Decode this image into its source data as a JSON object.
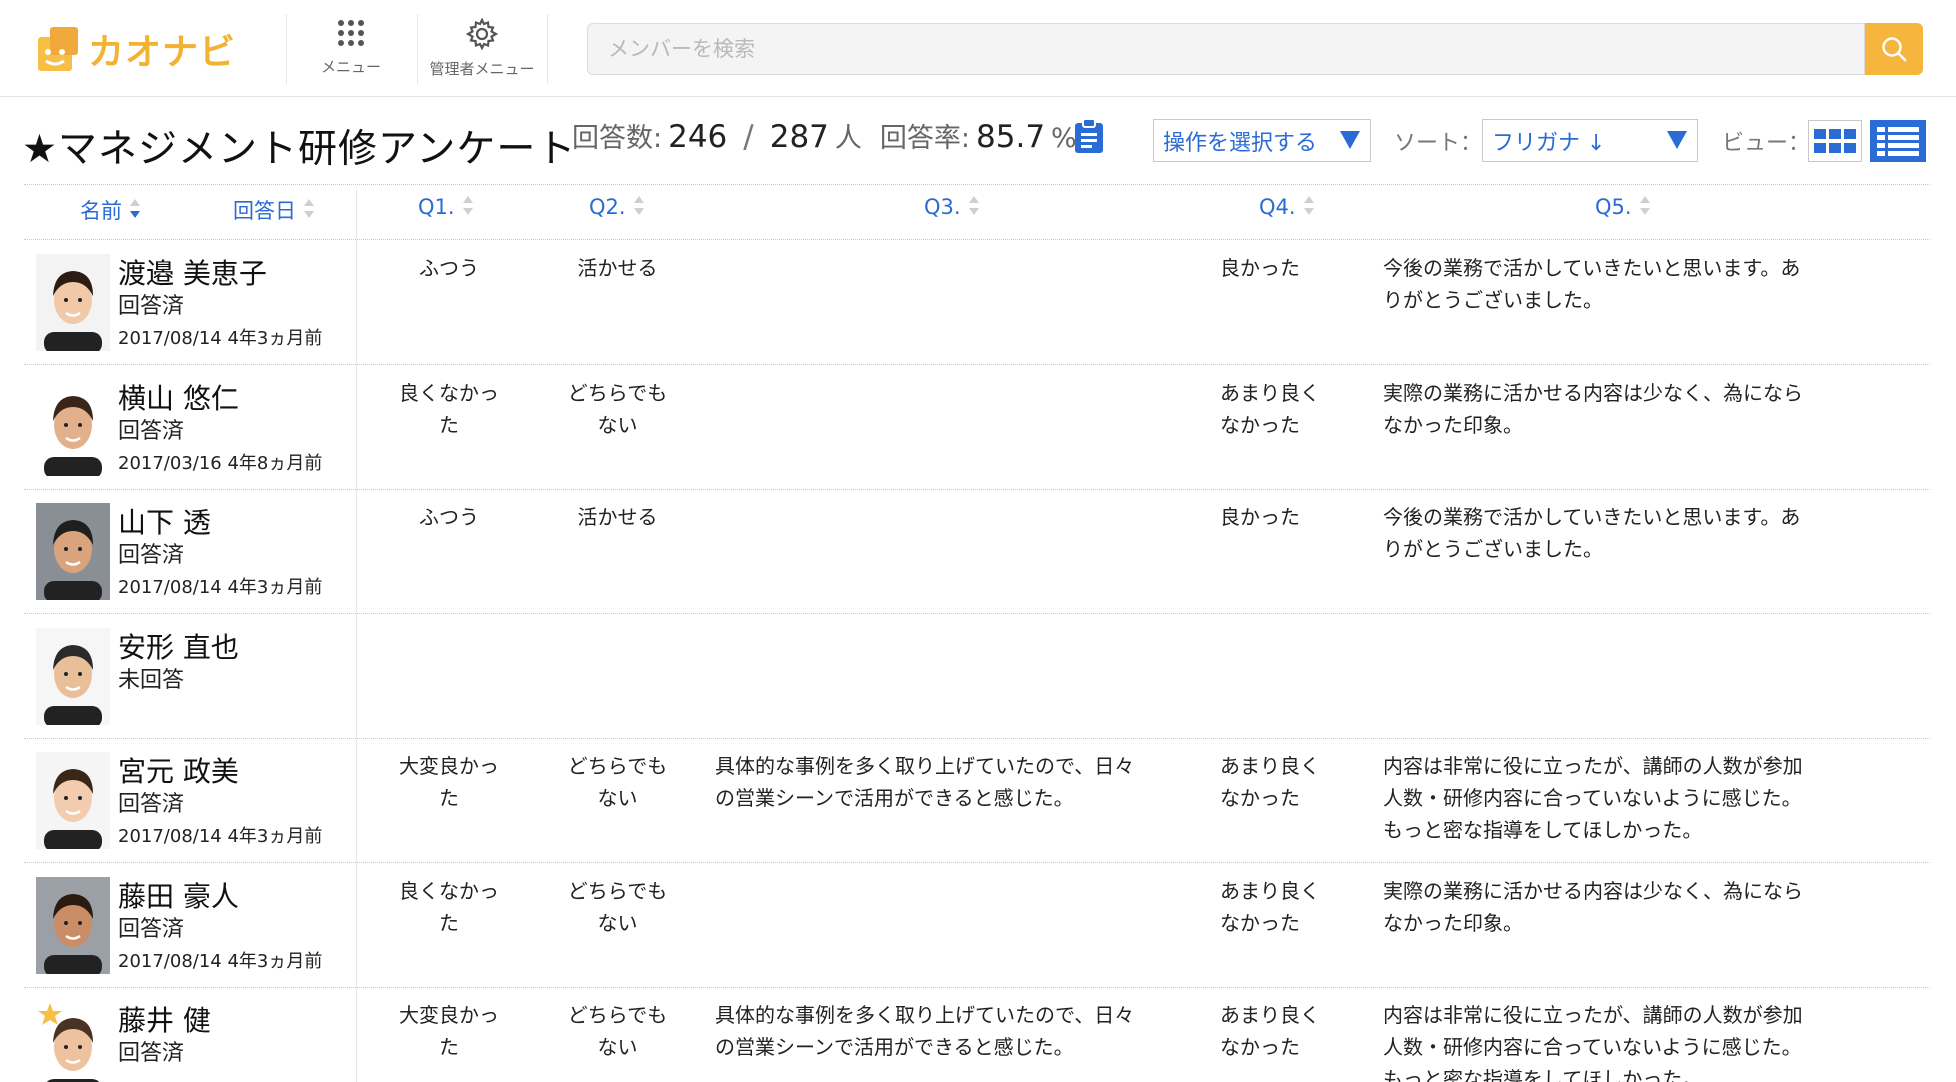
{
  "header": {
    "logo_text": "カオナビ",
    "menu_label": "メニュー",
    "admin_menu_label": "管理者メニュー",
    "search_placeholder": "メンバーを検索",
    "brand_color": "#f6b53c"
  },
  "survey": {
    "title": "★マネジメント研修アンケート",
    "responses_label": "回答数:",
    "responses_count": "246",
    "total_count": "287",
    "people_unit": "人",
    "rate_label": "回答率:",
    "rate_value": "85.7",
    "rate_unit": "%",
    "action_select": "操作を選択する",
    "sort_label": "ソート：",
    "sort_value": "フリガナ ↓",
    "view_label": "ビュー："
  },
  "columns": {
    "name": "名前",
    "answered_date": "回答日",
    "q1": "Q1.",
    "q2": "Q2.",
    "q3": "Q3.",
    "q4": "Q4.",
    "q5": "Q5."
  },
  "rows": [
    {
      "name": "渡邉 美恵子",
      "status": "回答済",
      "date": "2017/08/14 4年3ヵ月前",
      "q1": "ふつう",
      "q2": "活かせる",
      "q3": "",
      "q4": "良かった",
      "q5": "今後の業務で活かしていきたいと思います。あ\nりがとうございました。"
    },
    {
      "name": "横山 悠仁",
      "status": "回答済",
      "date": "2017/03/16 4年8ヵ月前",
      "q1": "良くなかっ\nた",
      "q2": "どちらでも\nない",
      "q3": "",
      "q4": "あまり良く\nなかった",
      "q5": "実際の業務に活かせる内容は少なく、為になら\nなかった印象。"
    },
    {
      "name": "山下 透",
      "status": "回答済",
      "date": "2017/08/14 4年3ヵ月前",
      "q1": "ふつう",
      "q2": "活かせる",
      "q3": "",
      "q4": "良かった",
      "q5": "今後の業務で活かしていきたいと思います。あ\nりがとうございました。"
    },
    {
      "name": "安形 直也",
      "status": "未回答",
      "date": "",
      "q1": "",
      "q2": "",
      "q3": "",
      "q4": "",
      "q5": ""
    },
    {
      "name": "宮元 政美",
      "status": "回答済",
      "date": "2017/08/14 4年3ヵ月前",
      "q1": "大変良かっ\nた",
      "q2": "どちらでも\nない",
      "q3": "具体的な事例を多く取り上げていたので、日々\nの営業シーンで活用ができると感じた。",
      "q4": "あまり良く\nなかった",
      "q5": "内容は非常に役に立ったが、講師の人数が参加\n人数・研修内容に合っていないように感じた。\nもっと密な指導をしてほしかった。"
    },
    {
      "name": "藤田 豪人",
      "status": "回答済",
      "date": "2017/08/14 4年3ヵ月前",
      "q1": "良くなかっ\nた",
      "q2": "どちらでも\nない",
      "q3": "",
      "q4": "あまり良く\nなかった",
      "q5": "実際の業務に活かせる内容は少なく、為になら\nなかった印象。"
    },
    {
      "name": "藤井 健",
      "status": "回答済",
      "date": "",
      "q1": "大変良かっ\nた",
      "q2": "どちらでも\nない",
      "q3": "具体的な事例を多く取り上げていたので、日々\nの営業シーンで活用ができると感じた。",
      "q4": "あまり良く\nなかった",
      "q5": "内容は非常に役に立ったが、講師の人数が参加\n人数・研修内容に合っていないように感じた。\nもっと密な指導をしてほしかった。"
    }
  ]
}
